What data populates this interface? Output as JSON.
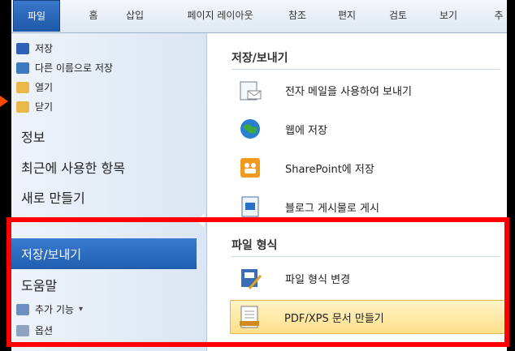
{
  "ribbon": {
    "tabs": [
      "파일",
      "홈",
      "삽입",
      "페이지 레이아웃",
      "참조",
      "편지",
      "검토",
      "보기",
      "추"
    ]
  },
  "left": {
    "small_items": [
      "저장",
      "다른 이름으로 저장",
      "열기",
      "닫기"
    ],
    "big_items": [
      "정보",
      "최근에 사용한 항목",
      "새로 만들기"
    ],
    "selected": "저장/보내기",
    "help": "도움말",
    "addins": "추가 기능",
    "addins_arrow": "▾",
    "options": "옵션"
  },
  "right": {
    "section1_title": "저장/보내기",
    "section1_items": [
      "전자 메일을 사용하여 보내기",
      "웹에 저장",
      "SharePoint에 저장",
      "블로그 게시물로 게시"
    ],
    "section2_title": "파일 형식",
    "section2_items": [
      "파일 형식 변경",
      "PDF/XPS 문서 만들기"
    ]
  },
  "colors": {
    "accent": "#1f5eaf",
    "highlight_border": "#ff0000",
    "hover": "#ffe08a"
  }
}
